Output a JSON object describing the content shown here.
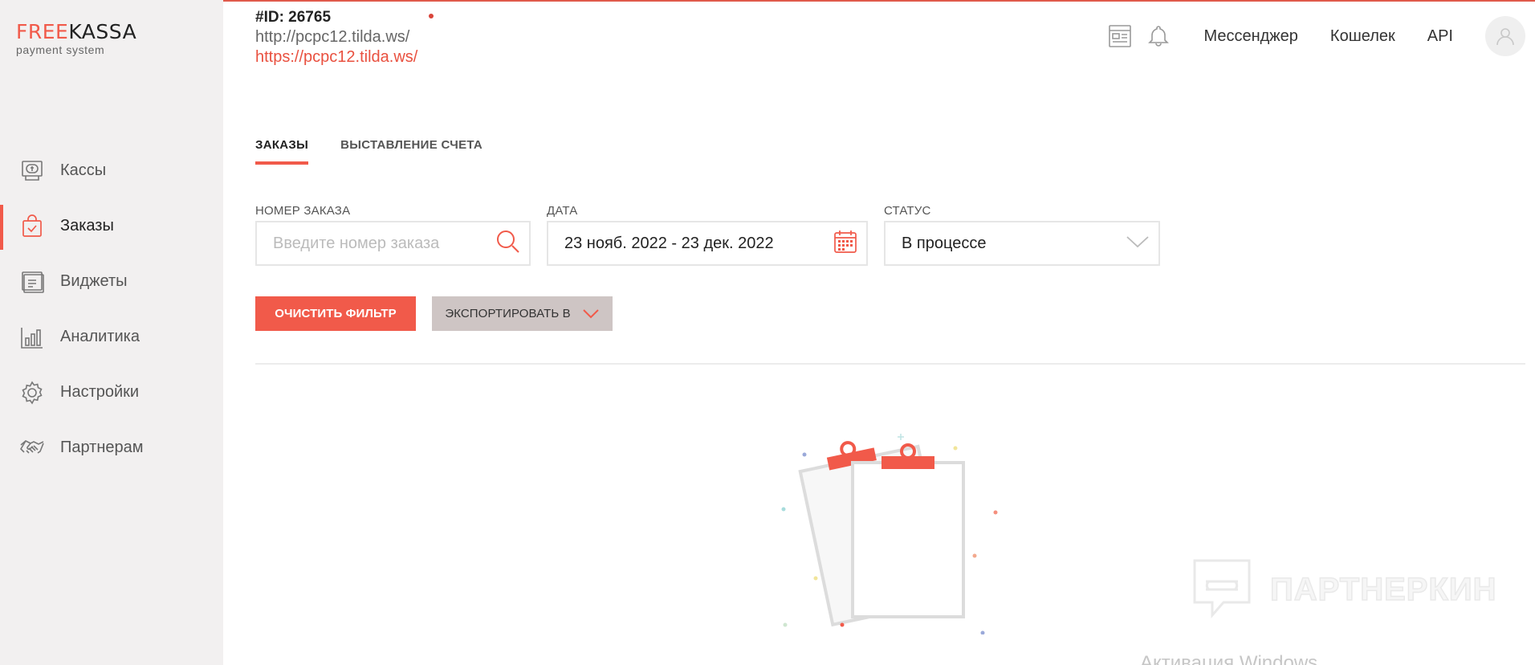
{
  "brand": {
    "logo_free": "FREE",
    "logo_kassa": "KASSA",
    "logo_sub": "payment system",
    "accent": "#f15a4a"
  },
  "site": {
    "id": "#ID: 26765",
    "url": "http://pcpc12.tilda.ws/",
    "url_secure": "https://pcpc12.tilda.ws/"
  },
  "header": {
    "icons": [
      "widget-panel-icon",
      "bell-icon"
    ],
    "links": [
      "Мессенджер",
      "Кошелек",
      "API"
    ]
  },
  "sidebar": {
    "items": [
      {
        "label": "Кассы",
        "icon": "cashbox-icon",
        "active": false
      },
      {
        "label": "Заказы",
        "icon": "orders-bag-icon",
        "active": true
      },
      {
        "label": "Виджеты",
        "icon": "widgets-icon",
        "active": false
      },
      {
        "label": "Аналитика",
        "icon": "analytics-chart-icon",
        "active": false
      },
      {
        "label": "Настройки",
        "icon": "gear-icon",
        "active": false
      },
      {
        "label": "Партнерам",
        "icon": "handshake-icon",
        "active": false
      }
    ]
  },
  "tabs": [
    {
      "label": "ЗАКАЗЫ",
      "active": true
    },
    {
      "label": "ВЫСТАВЛЕНИЕ СЧЕТА",
      "active": false
    }
  ],
  "filters": {
    "order_number": {
      "label": "НОМЕР ЗАКАЗА",
      "placeholder": "Введите номер заказа",
      "value": ""
    },
    "date": {
      "label": "ДАТА",
      "value": "23 нояб. 2022 - 23 дек. 2022"
    },
    "status": {
      "label": "СТАТУС",
      "value": "В процессе"
    }
  },
  "buttons": {
    "clear": "ОЧИСТИТЬ ФИЛЬТР",
    "export": "ЭКСПОРТИРОВАТЬ В"
  },
  "watermark": {
    "text": "ПАРТНЕРКИН",
    "windows": "Активация Windows"
  }
}
